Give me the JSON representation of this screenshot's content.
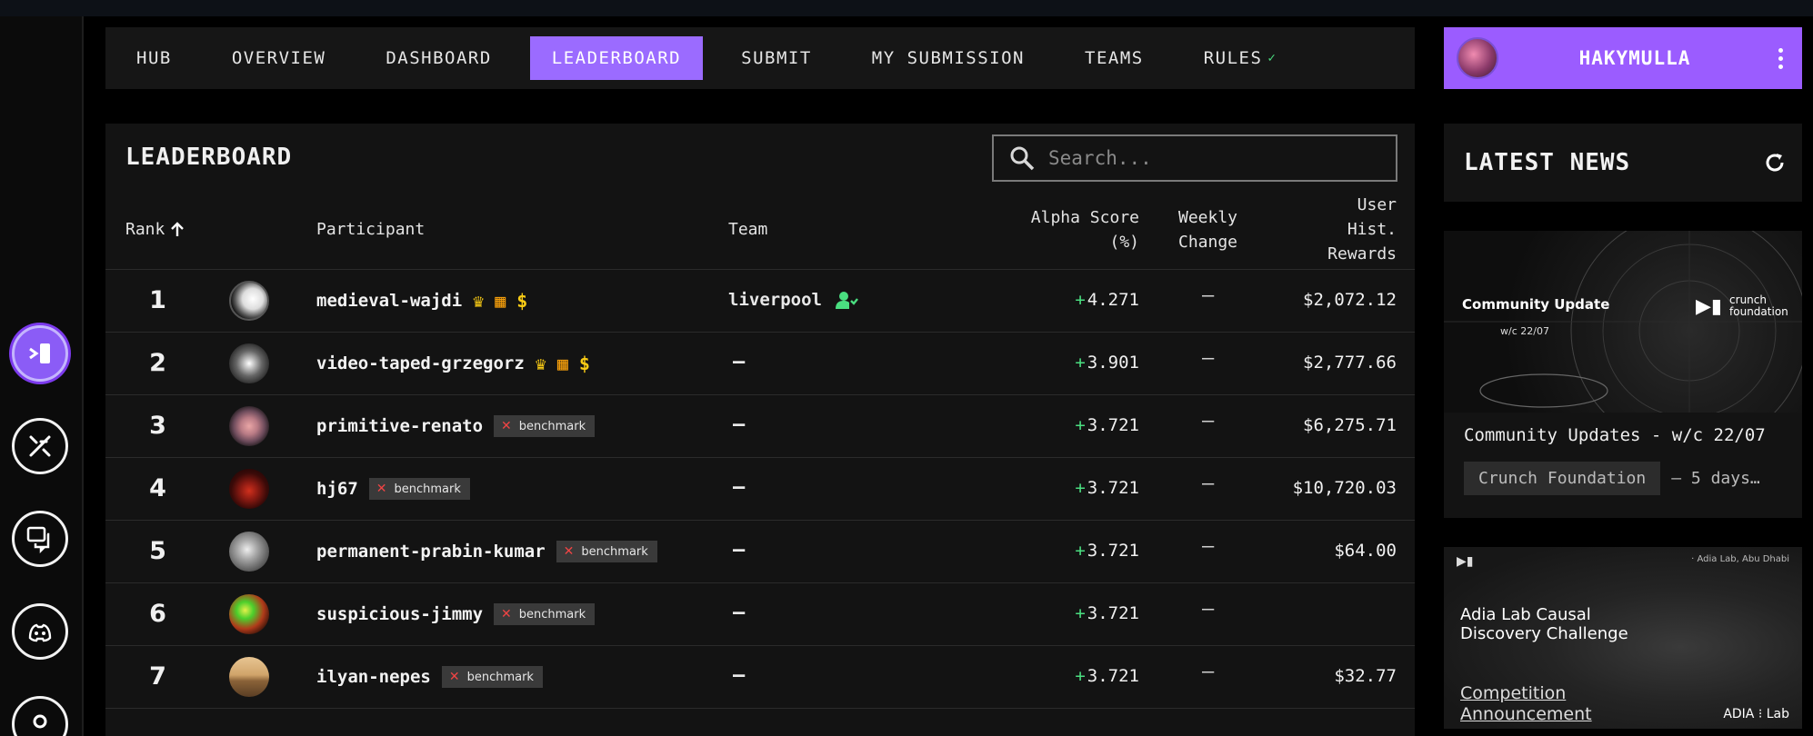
{
  "nav": {
    "items": [
      {
        "label": "HUB"
      },
      {
        "label": "OVERVIEW"
      },
      {
        "label": "DASHBOARD"
      },
      {
        "label": "LEADERBOARD",
        "active": true
      },
      {
        "label": "SUBMIT"
      },
      {
        "label": "MY SUBMISSION"
      },
      {
        "label": "TEAMS"
      },
      {
        "label": "RULES",
        "badge_icon": "check-icon"
      }
    ],
    "accent": "#9b6bff"
  },
  "user": {
    "name": "HAKYMULLA",
    "menu_icon": "kebab-menu-icon",
    "box_color": "#9b5cff"
  },
  "rail": {
    "icons": [
      "competition-icon",
      "tools-icon",
      "forum-icon",
      "discord-icon",
      "account-icon"
    ]
  },
  "leaderboard": {
    "title": "LEADERBOARD",
    "search_placeholder": "Search...",
    "columns": {
      "rank": "Rank",
      "participant": "Participant",
      "team": "Team",
      "alpha_l1": "Alpha Score",
      "alpha_l2": "(%)",
      "weekly_l1": "Weekly",
      "weekly_l2": "Change",
      "rewards_l1": "User",
      "rewards_l2": "Hist.",
      "rewards_l3": "Rewards"
    },
    "rows": [
      {
        "rank": "1",
        "name": "medieval-wajdi",
        "team": "liverpool",
        "alpha": "4.271",
        "weekly": "—",
        "reward": "$2,072.12",
        "icons": [
          "crown-icon",
          "certificate-icon",
          "dollar-icon"
        ]
      },
      {
        "rank": "2",
        "name": "video-taped-grzegorz",
        "team": "—",
        "alpha": "3.901",
        "weekly": "—",
        "reward": "$2,777.66",
        "icons": [
          "crown-icon",
          "certificate-icon",
          "dollar-icon"
        ]
      },
      {
        "rank": "3",
        "name": "primitive-renato",
        "team": "—",
        "alpha": "3.721",
        "weekly": "—",
        "reward": "$6,275.71",
        "badge": "benchmark"
      },
      {
        "rank": "4",
        "name": "hj67",
        "team": "—",
        "alpha": "3.721",
        "weekly": "—",
        "reward": "$10,720.03",
        "badge": "benchmark"
      },
      {
        "rank": "5",
        "name": "permanent-prabin-kumar",
        "team": "—",
        "alpha": "3.721",
        "weekly": "—",
        "reward": "$64.00",
        "badge": "benchmark"
      },
      {
        "rank": "6",
        "name": "suspicious-jimmy",
        "team": "—",
        "alpha": "3.721",
        "weekly": "—",
        "reward": "",
        "badge": "benchmark"
      },
      {
        "rank": "7",
        "name": "ilyan-nepes",
        "team": "—",
        "alpha": "3.721",
        "weekly": "—",
        "reward": "$32.77",
        "badge": "benchmark"
      }
    ],
    "colors": {
      "positive": "#4ade80",
      "cross": "#ef4444",
      "gold": "#facc15",
      "team_icon": "#4ade80"
    }
  },
  "news": {
    "title": "LATEST NEWS",
    "card1": {
      "image_title": "Community Update",
      "image_sub": "w/c 22/07",
      "brand_l1": "crunch",
      "brand_l2": "foundation",
      "caption": "Community Updates - w/c 22/07",
      "source": "Crunch Foundation",
      "ago": "— 5 days…"
    },
    "card2": {
      "location": "· Adia Lab, Abu Dhabi",
      "title": "Adia Lab Causal Discovery Challenge",
      "announcement": "Competition Announcement",
      "footer": "ADIA ⁝ Lab"
    }
  }
}
